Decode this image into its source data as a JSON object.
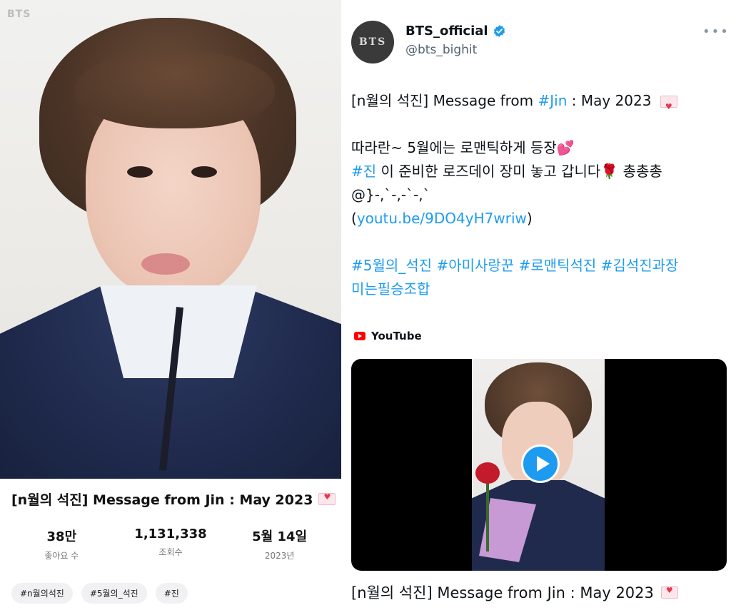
{
  "left_panel": {
    "watermark": "BTS",
    "title": "[n월의 석진] Message from Jin : May 2023",
    "stats": [
      {
        "value": "38만",
        "label": "좋아요 수"
      },
      {
        "value": "1,131,338",
        "label": "조회수"
      },
      {
        "value": "5월 14일",
        "label": "2023년"
      }
    ],
    "tags": [
      "#n월의석진",
      "#5월의_석진",
      "#진"
    ]
  },
  "tweet": {
    "avatar_text": "BTS",
    "display_name": "BTS_official",
    "handle": "@bts_bighit",
    "verified_icon": "verified-badge-icon",
    "lines": {
      "l1_prefix": "[n월의 석진] Message from ",
      "l1_link": "#Jin",
      "l1_suffix": " : May 2023",
      "l2": "따라란~ 5월에는 로맨틱하게 등장",
      "l2_emoji": "💕",
      "l3_link": "#진",
      "l3_text": " 이 준비한 로즈데이 장미 놓고 갑니다",
      "l3_emoji": "🌹",
      "l3_suffix": " 총총총",
      "l4": "@}-,`-,-`-,`",
      "l5_open": "(",
      "l5_link": "youtu.be/9DO4yH7wriw",
      "l5_close": ")",
      "hashtags_line1": "#5월의_석진 #아미사랑꾼 #로맨틱석진 #김석진과장",
      "hashtags_line2": "미는필승조합"
    },
    "card": {
      "source": "YouTube",
      "title": "[n월의 석진] Message from Jin : May 2023"
    }
  },
  "colors": {
    "link": "#1d9bf0",
    "text": "#0f1419",
    "secondary": "#536471"
  }
}
